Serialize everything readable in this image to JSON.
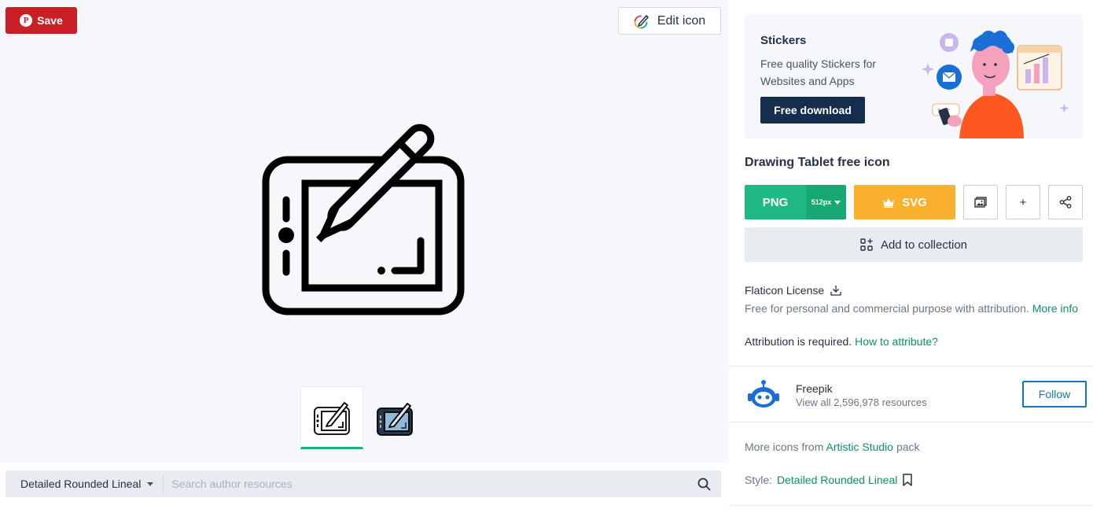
{
  "toolbar": {
    "save_label": "Save",
    "edit_label": "Edit icon"
  },
  "preview": {
    "icon_name": "drawing-tablet-icon",
    "variants": [
      "lineal",
      "filled"
    ]
  },
  "search": {
    "style_label": "Detailed Rounded Lineal",
    "placeholder": "Search author resources"
  },
  "promo": {
    "title": "Stickers",
    "text": "Free quality Stickers for Websites and Apps",
    "button": "Free download"
  },
  "icon": {
    "title": "Drawing Tablet free icon"
  },
  "download": {
    "png_label": "PNG",
    "size_label": "512px",
    "svg_label": "SVG",
    "more_label": "+",
    "collection_label": "Add to collection"
  },
  "license": {
    "name": "Flaticon License",
    "text": "Free for personal and commercial purpose with attribution.",
    "more_info": "More info",
    "attribution": "Attribution is required.",
    "how_to": "How to attribute?"
  },
  "author": {
    "name": "Freepik",
    "resources": "View all 2,596,978 resources",
    "follow": "Follow"
  },
  "pack": {
    "prefix": "More icons from",
    "name": "Artistic Studio",
    "suffix": "pack"
  },
  "style": {
    "prefix": "Style:",
    "name": "Detailed Rounded Lineal"
  },
  "colors": {
    "save": "#cb1f27",
    "png": "#1fb983",
    "svg": "#fbb02d",
    "link": "#0f8f6a",
    "follow": "#1577bb",
    "promo_button": "#172d4e"
  }
}
